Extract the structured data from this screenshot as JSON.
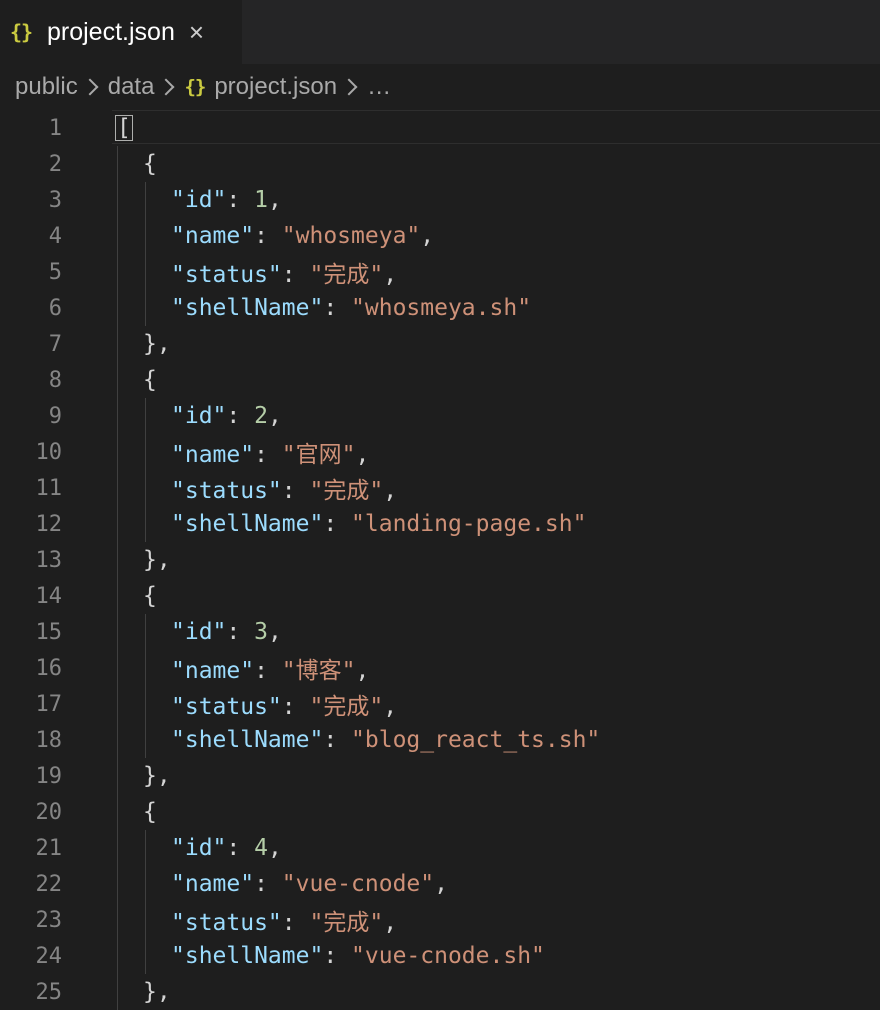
{
  "tab": {
    "icon": "{}",
    "label": "project.json",
    "close": "×"
  },
  "breadcrumb": {
    "items": [
      "public",
      "data",
      "project.json",
      "…"
    ],
    "file_icon": "{}"
  },
  "colors": {
    "key": "#9cdcfe",
    "string": "#ce9178",
    "number": "#b5cea8",
    "punct": "#d4d4d4",
    "json_icon": "#cbcb41"
  },
  "lines": [
    {
      "n": "1",
      "indent": 0,
      "parts": [
        [
          "p",
          "["
        ]
      ],
      "cursor": true
    },
    {
      "n": "2",
      "indent": 1,
      "parts": [
        [
          "p",
          "{"
        ]
      ]
    },
    {
      "n": "3",
      "indent": 2,
      "parts": [
        [
          "k",
          "\"id\""
        ],
        [
          "p",
          ": "
        ],
        [
          "n",
          "1"
        ],
        [
          "p",
          ","
        ]
      ]
    },
    {
      "n": "4",
      "indent": 2,
      "parts": [
        [
          "k",
          "\"name\""
        ],
        [
          "p",
          ": "
        ],
        [
          "s",
          "\"whosmeya\""
        ],
        [
          "p",
          ","
        ]
      ]
    },
    {
      "n": "5",
      "indent": 2,
      "parts": [
        [
          "k",
          "\"status\""
        ],
        [
          "p",
          ": "
        ],
        [
          "s",
          "\"完成\""
        ],
        [
          "p",
          ","
        ]
      ]
    },
    {
      "n": "6",
      "indent": 2,
      "parts": [
        [
          "k",
          "\"shellName\""
        ],
        [
          "p",
          ": "
        ],
        [
          "s",
          "\"whosmeya.sh\""
        ]
      ]
    },
    {
      "n": "7",
      "indent": 1,
      "parts": [
        [
          "p",
          "},"
        ]
      ]
    },
    {
      "n": "8",
      "indent": 1,
      "parts": [
        [
          "p",
          "{"
        ]
      ]
    },
    {
      "n": "9",
      "indent": 2,
      "parts": [
        [
          "k",
          "\"id\""
        ],
        [
          "p",
          ": "
        ],
        [
          "n",
          "2"
        ],
        [
          "p",
          ","
        ]
      ]
    },
    {
      "n": "10",
      "indent": 2,
      "parts": [
        [
          "k",
          "\"name\""
        ],
        [
          "p",
          ": "
        ],
        [
          "s",
          "\"官网\""
        ],
        [
          "p",
          ","
        ]
      ]
    },
    {
      "n": "11",
      "indent": 2,
      "parts": [
        [
          "k",
          "\"status\""
        ],
        [
          "p",
          ": "
        ],
        [
          "s",
          "\"完成\""
        ],
        [
          "p",
          ","
        ]
      ]
    },
    {
      "n": "12",
      "indent": 2,
      "parts": [
        [
          "k",
          "\"shellName\""
        ],
        [
          "p",
          ": "
        ],
        [
          "s",
          "\"landing-page.sh\""
        ]
      ]
    },
    {
      "n": "13",
      "indent": 1,
      "parts": [
        [
          "p",
          "},"
        ]
      ]
    },
    {
      "n": "14",
      "indent": 1,
      "parts": [
        [
          "p",
          "{"
        ]
      ]
    },
    {
      "n": "15",
      "indent": 2,
      "parts": [
        [
          "k",
          "\"id\""
        ],
        [
          "p",
          ": "
        ],
        [
          "n",
          "3"
        ],
        [
          "p",
          ","
        ]
      ]
    },
    {
      "n": "16",
      "indent": 2,
      "parts": [
        [
          "k",
          "\"name\""
        ],
        [
          "p",
          ": "
        ],
        [
          "s",
          "\"博客\""
        ],
        [
          "p",
          ","
        ]
      ]
    },
    {
      "n": "17",
      "indent": 2,
      "parts": [
        [
          "k",
          "\"status\""
        ],
        [
          "p",
          ": "
        ],
        [
          "s",
          "\"完成\""
        ],
        [
          "p",
          ","
        ]
      ]
    },
    {
      "n": "18",
      "indent": 2,
      "parts": [
        [
          "k",
          "\"shellName\""
        ],
        [
          "p",
          ": "
        ],
        [
          "s",
          "\"blog_react_ts.sh\""
        ]
      ]
    },
    {
      "n": "19",
      "indent": 1,
      "parts": [
        [
          "p",
          "},"
        ]
      ]
    },
    {
      "n": "20",
      "indent": 1,
      "parts": [
        [
          "p",
          "{"
        ]
      ]
    },
    {
      "n": "21",
      "indent": 2,
      "parts": [
        [
          "k",
          "\"id\""
        ],
        [
          "p",
          ": "
        ],
        [
          "n",
          "4"
        ],
        [
          "p",
          ","
        ]
      ]
    },
    {
      "n": "22",
      "indent": 2,
      "parts": [
        [
          "k",
          "\"name\""
        ],
        [
          "p",
          ": "
        ],
        [
          "s",
          "\"vue-cnode\""
        ],
        [
          "p",
          ","
        ]
      ]
    },
    {
      "n": "23",
      "indent": 2,
      "parts": [
        [
          "k",
          "\"status\""
        ],
        [
          "p",
          ": "
        ],
        [
          "s",
          "\"完成\""
        ],
        [
          "p",
          ","
        ]
      ]
    },
    {
      "n": "24",
      "indent": 2,
      "parts": [
        [
          "k",
          "\"shellName\""
        ],
        [
          "p",
          ": "
        ],
        [
          "s",
          "\"vue-cnode.sh\""
        ]
      ]
    },
    {
      "n": "25",
      "indent": 1,
      "parts": [
        [
          "p",
          "},"
        ]
      ]
    }
  ]
}
